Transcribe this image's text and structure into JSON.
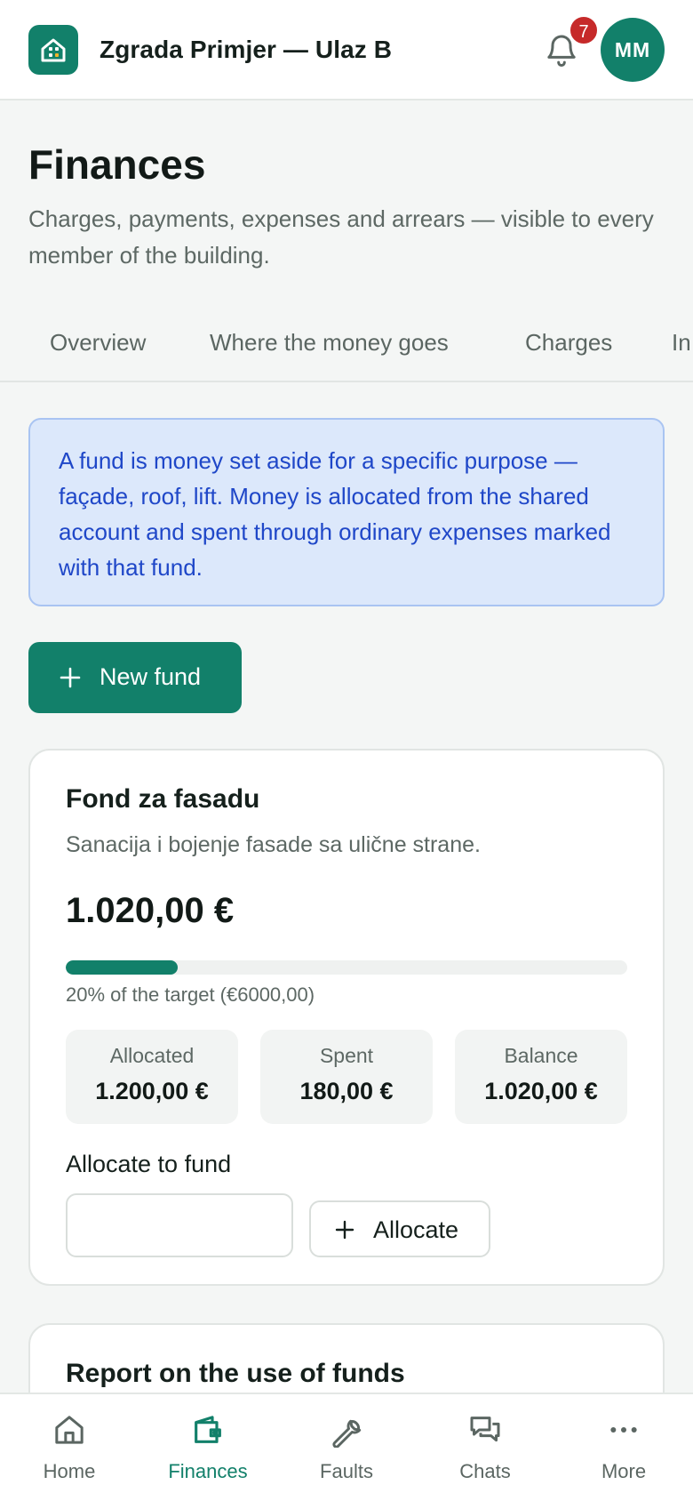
{
  "header": {
    "title": "Zgrada Primjer — Ulaz B",
    "notification_count": "7",
    "avatar_initials": "MM"
  },
  "page": {
    "title": "Finances",
    "subtitle": "Charges, payments, expenses and arrears — visible to every member of the building."
  },
  "tabs": [
    {
      "label": "Overview"
    },
    {
      "label": "Where the money goes"
    },
    {
      "label": "Charges"
    },
    {
      "label": "In"
    }
  ],
  "info_text": "A fund is money set aside for a specific purpose — façade, roof, lift. Money is allocated from the shared account and spent through ordinary expenses marked with that fund.",
  "new_fund_label": "New fund",
  "fund": {
    "name": "Fond za fasadu",
    "description": "Sanacija i bojenje fasade sa ulične strane.",
    "balance_display": "1.020,00 €",
    "progress_fraction": 0.2,
    "progress_text": "20% of the target (€6000,00)",
    "stats": [
      {
        "label": "Allocated",
        "value": "1.200,00 €"
      },
      {
        "label": "Spent",
        "value": "180,00 €"
      },
      {
        "label": "Balance",
        "value": "1.020,00 €"
      }
    ],
    "allocate_label": "Allocate to fund",
    "allocate_input_value": "",
    "allocate_button": "Allocate"
  },
  "report": {
    "title": "Report on the use of funds"
  },
  "bottom_nav": [
    {
      "label": "Home",
      "icon": "home-icon"
    },
    {
      "label": "Finances",
      "icon": "wallet-icon",
      "active": true
    },
    {
      "label": "Faults",
      "icon": "wrench-icon"
    },
    {
      "label": "Chats",
      "icon": "chat-icon"
    },
    {
      "label": "More",
      "icon": "more-icon"
    }
  ],
  "colors": {
    "brand": "#12806a",
    "info_bg": "#dce8fb",
    "info_text": "#1f47c8",
    "badge": "#c62a2a"
  }
}
